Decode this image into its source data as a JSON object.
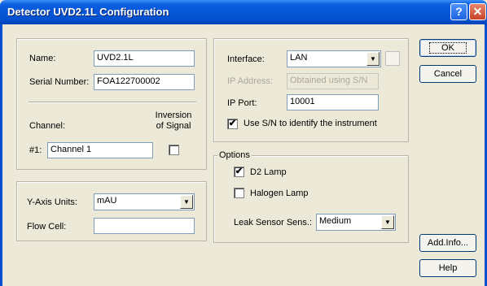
{
  "window": {
    "title": "Detector UVD2.1L Configuration",
    "help_glyph": "?",
    "close_glyph": "✕"
  },
  "identity": {
    "name_label": "Name:",
    "name_value": "UVD2.1L",
    "serial_label": "Serial Number:",
    "serial_value": "FOA122700002",
    "channel_header": "Channel:",
    "inversion_header": "Inversion of Signal",
    "channel1_label": "#1:",
    "channel1_value": "Channel 1"
  },
  "units": {
    "yaxis_label": "Y-Axis Units:",
    "yaxis_value": "mAU",
    "flowcell_label": "Flow Cell:",
    "flowcell_value": ""
  },
  "interface": {
    "interface_label": "Interface:",
    "interface_value": "LAN",
    "ip_label": "IP Address:",
    "ip_value": "Obtained using S/N",
    "port_label": "IP Port:",
    "port_value": "10001",
    "use_sn_label": "Use S/N to identify the instrument",
    "use_sn_checked": "✔"
  },
  "options": {
    "legend": "Options",
    "d2_label": "D2 Lamp",
    "d2_checked": "✔",
    "halogen_label": "Halogen Lamp",
    "leak_label": "Leak Sensor Sens.:",
    "leak_value": "Medium"
  },
  "buttons": {
    "ok": "OK",
    "cancel": "Cancel",
    "addinfo": "Add.Info...",
    "help": "Help"
  },
  "icons": {
    "dropdown_arrow": "▼"
  }
}
